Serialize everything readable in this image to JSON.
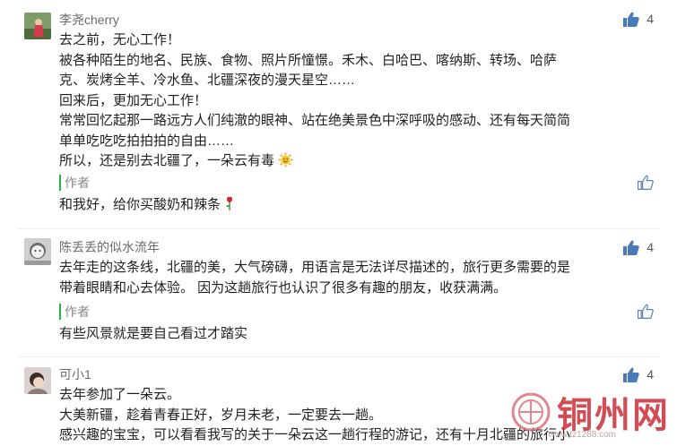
{
  "comments": [
    {
      "name": "李尧cherry",
      "likes": "4",
      "lines": [
        "去之前，无心工作！",
        "被各种陌生的地名、民族、食物、照片所憧憬。禾木、白哈巴、喀纳斯、转场、哈萨",
        "克、炭烤全羊、冷水鱼、北疆深夜的漫天星空……",
        "回来后，更加无心工作！",
        "常常回忆起那一路远方人们纯澈的眼神、站在绝美景色中深呼吸的感动、还有每天简简",
        "单单吃吃吃拍拍拍的自由……",
        "所以，还是别去北疆了，一朵云有毒"
      ],
      "reply": {
        "tag": "作者",
        "text": "和我好，给你买酸奶和辣条"
      }
    },
    {
      "name": "陈丢丢的似水流年",
      "likes": "4",
      "lines": [
        "去年走的这条线，北疆的美，大气磅礴，用语言是无法详尽描述的，旅行更多需要的是",
        "带着眼睛和心去体验。 因为这趟旅行也认识了很多有趣的朋友，收获满满。"
      ],
      "reply": {
        "tag": "作者",
        "text": "有些风景就是要自己看过才踏实"
      }
    },
    {
      "name": "可小1",
      "likes": "4",
      "lines": [
        "去年参加了一朵云。",
        "大美新疆，趁着青春正好，岁月未老，一定要去一趟。",
        "感兴趣的宝宝，可以看看我写的关于一朵云这一趟行程的游记，还有十月北疆的旅行小"
      ]
    }
  ],
  "watermark": {
    "text": "铜州网",
    "url": "www.tz1288.com"
  },
  "colors": {
    "like_icon": "#4a7ab8",
    "author_bar": "#2db23d",
    "watermark": "#c8202c"
  }
}
